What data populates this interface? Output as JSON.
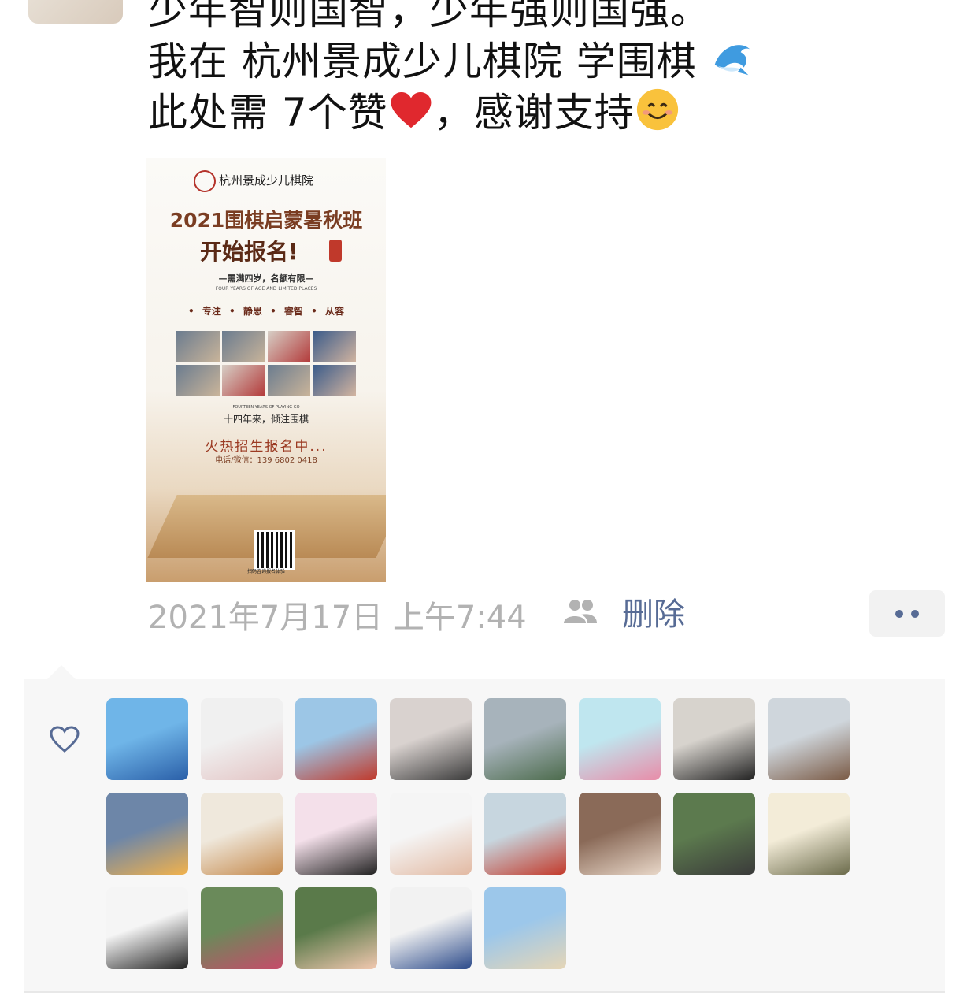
{
  "post": {
    "lines": [
      "少年智则国智，少年强则国强。",
      "我在 杭州景成少儿棋院 学围棋",
      "此处需 7个赞",
      "，感谢支持"
    ],
    "emojis": {
      "dolphin": "dolphin-emoji",
      "heart": "heart-emoji",
      "smile": "smile-emoji"
    }
  },
  "poster": {
    "logo_text": "杭州景成少儿棋院",
    "title": "2021围棋启蒙暑秋班",
    "title2": "开始报名!",
    "subtitle": "—需满四岁，名额有限—",
    "subtitle_en": "FOUR YEARS OF AGE AND LIMITED PLACES",
    "tags": "• 专注  • 静思  • 睿智  • 从容",
    "years_en": "FOURTEEN YEARS OF PLAYING GO",
    "years": "十四年来，倾注围棋",
    "hot": "火热招生报名中...",
    "phone": "电话/微信：139 6802 0418",
    "qr_caption": "扫码咨询报名体验"
  },
  "meta": {
    "timestamp": "2021年7月17日 上午7:44",
    "delete_label": "删除"
  },
  "likes": {
    "count": 21,
    "avatars": [
      "avatar-1",
      "avatar-2",
      "avatar-3",
      "avatar-4",
      "avatar-5",
      "avatar-6",
      "avatar-7",
      "avatar-8",
      "avatar-9",
      "avatar-10",
      "avatar-11",
      "avatar-12",
      "avatar-13",
      "avatar-14",
      "avatar-15",
      "avatar-16",
      "avatar-17",
      "avatar-18",
      "avatar-19",
      "avatar-20",
      "avatar-21"
    ]
  },
  "colors": {
    "link": "#576b95",
    "meta_gray": "#b2b2b2",
    "likes_bg": "#f7f7f7"
  }
}
